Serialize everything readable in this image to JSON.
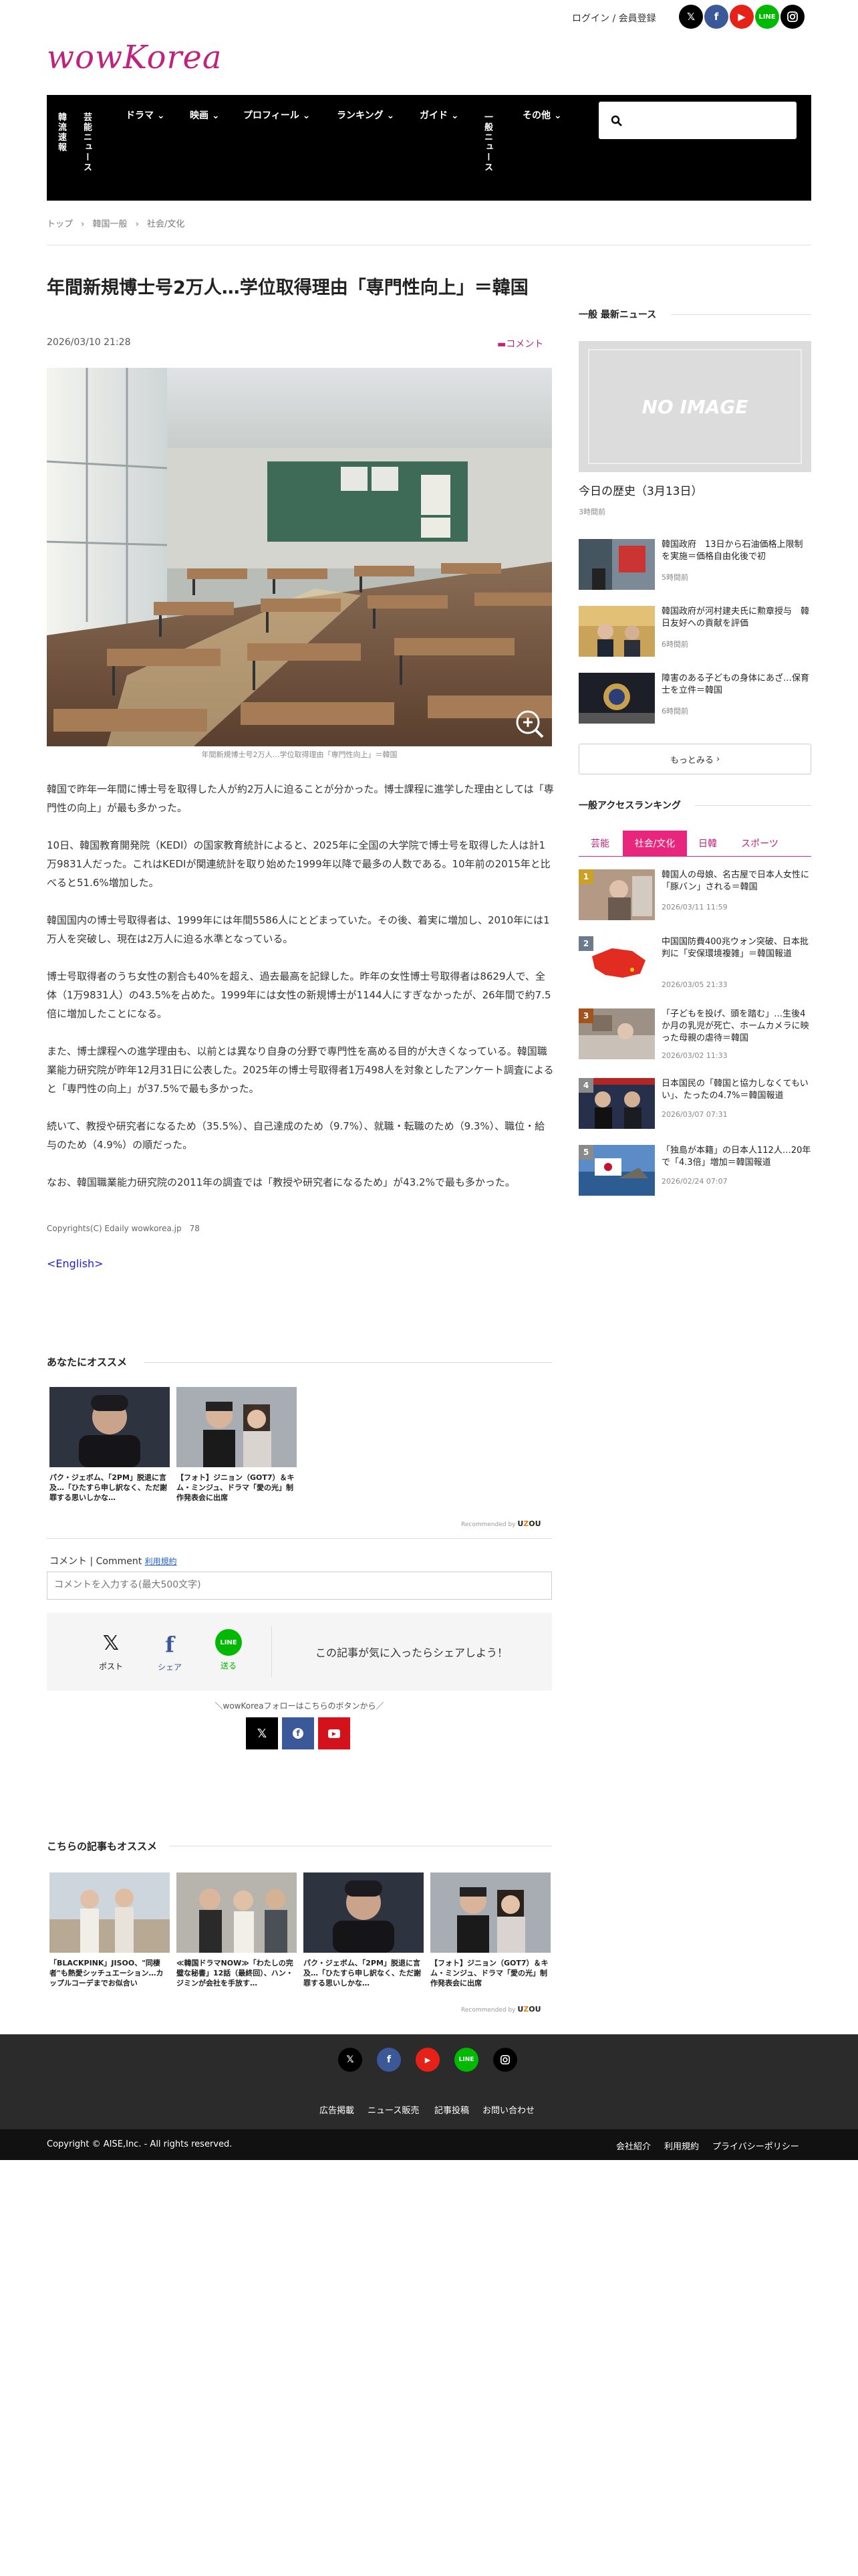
{
  "header": {
    "login_label": "ログイン / 会員登録",
    "logo": "wowKorea",
    "social": [
      "x-icon",
      "facebook-icon",
      "youtube-icon",
      "line-icon",
      "instagram-icon"
    ]
  },
  "nav": {
    "vertical": [
      "韓流速報",
      "芸能ニュース",
      "一般ニュース"
    ],
    "items": [
      "ドラマ",
      "映画",
      "プロフィール",
      "ランキング",
      "ガイド",
      "その他"
    ],
    "search_placeholder": ""
  },
  "breadcrumb": [
    "トップ",
    "韓国一般",
    "社会/文化"
  ],
  "article": {
    "title": "年間新規博士号2万人…学位取得理由「専門性向上」＝韓国",
    "date": "2026/03/10 21:28",
    "comment_label": "コメント",
    "caption": "年間新規博士号2万人…学位取得理由「専門性向上」＝韓国",
    "paragraphs": [
      "韓国で昨年一年間に博士号を取得した人が約2万人に迫ることが分かった。博士課程に進学した理由としては「専門性の向上」が最も多かった。",
      "10日、韓国教育開発院（KEDI）の国家教育統計によると、2025年に全国の大学院で博士号を取得した人は計1万9831人だった。これはKEDIが関連統計を取り始めた1999年以降で最多の人数である。10年前の2015年と比べると51.6%増加した。",
      "韓国国内の博士号取得者は、1999年には年間5586人にとどまっていた。その後、着実に増加し、2010年には1万人を突破し、現在は2万人に迫る水準となっている。",
      "博士号取得者のうち女性の割合も40%を超え、過去最高を記録した。昨年の女性博士号取得者は8629人で、全体（1万9831人）の43.5%を占めた。1999年には女性の新規博士が1144人にすぎなかったが、26年間で約7.5倍に増加したことになる。",
      "また、博士課程への進学理由も、以前とは異なり自身の分野で専門性を高める目的が大きくなっている。韓国職業能力研究院が昨年12月31日に公表した。2025年の博士号取得者1万498人を対象としたアンケート調査によると「専門性の向上」が37.5%で最も多かった。",
      "続いて、教授や研究者になるため（35.5%）、自己達成のため（9.7%）、就職・転職のため（9.3%）、職位・給与のため（4.9%）の順だった。",
      "なお、韓国職業能力研究院の2011年の調査では「教授や研究者になるため」が43.2%で最も多かった。"
    ],
    "copyright": "Copyrights(C) Edaily wowkorea.jp　78",
    "english_link": "<English>"
  },
  "reco1": {
    "heading": "あなたにオススメ",
    "cards": [
      "パク・ジェボム、「2PM」脱退に言及…「ひたすら申し訳なく、ただ謝罪する思いしかな…",
      "【フォト】ジニョン（GOT7）＆キム・ミンジュ、ドラマ「愛の光」制作発表会に出席"
    ],
    "powered": "Recommended by"
  },
  "comment": {
    "label": "コメント | Comment",
    "terms": "利用規約",
    "placeholder": "コメントを入力する(最大500文字)"
  },
  "share": {
    "buttons": [
      "ポスト",
      "シェア",
      "送る"
    ],
    "message": "この記事が気に入ったらシェアしよう！",
    "follow": "＼wowKoreaフォローはこちらのボタンから／"
  },
  "reco2": {
    "heading": "こちらの記事もオススメ",
    "cards": [
      "「BLACKPINK」JISOO、\"同棲者\"も熱愛シッチュエーション…カップルコーデまでお似合い",
      "≪韓国ドラマNOW≫「わたしの完璧な秘書」12話（最終回）、ハン・ジミンが会社を手放す…",
      "パク・ジェボム、「2PM」脱退に言及…「ひたすら申し訳なく、ただ謝罪する思いしかな…",
      "【フォト】ジニョン（GOT7）＆キム・ミンジュ、ドラマ「愛の光」制作発表会に出席"
    ],
    "powered": "Recommended by"
  },
  "sidebar": {
    "latest_heading": "一般 最新ニュース",
    "no_image": "NO IMAGE",
    "today_title": "今日の歴史（3月13日）",
    "today_time": "3時間前",
    "latest": [
      {
        "title": "韓国政府　13日から石油価格上限制を実施＝価格自由化後で初",
        "time": "5時間前"
      },
      {
        "title": "韓国政府が河村建夫氏に勲章授与　韓日友好への貢献を評価",
        "time": "6時間前"
      },
      {
        "title": "障害のある子どもの身体にあざ…保育士を立件＝韓国",
        "time": "6時間前"
      }
    ],
    "more": "もっとみる",
    "ranking_heading": "一般アクセスランキング",
    "tabs": [
      "芸能",
      "社会/文化",
      "日韓",
      "スポーツ"
    ],
    "ranking": [
      {
        "title": "韓国人の母娘、名古屋で日本人女性に「豚バン」される＝韓国",
        "time": "2026/03/11 11:59"
      },
      {
        "title": "中国国防費400兆ウォン突破、日本批判に「安保環境複雑」＝韓国報道",
        "time": "2026/03/05 21:33"
      },
      {
        "title": "「子どもを投げ、頭を踏む」…生後4か月の乳児が死亡、ホームカメラに映った母親の虐待＝韓国",
        "time": "2026/03/02 11:33"
      },
      {
        "title": "日本国民の「韓国と協力しなくてもいい」、たったの4.7%＝韓国報道",
        "time": "2026/03/07 07:31"
      },
      {
        "title": "「独島が本籍」の日本人112人…20年で「4.3倍」増加＝韓国報道",
        "time": "2026/02/24 07:07"
      }
    ]
  },
  "footer": {
    "links": [
      "広告掲載",
      "ニュース販売",
      "記事投稿",
      "お問い合わせ"
    ],
    "copyright": "Copyright © AISE,Inc. - All rights reserved.",
    "bottom_links": [
      "会社紹介",
      "利用規約",
      "プライバシーポリシー"
    ]
  },
  "colors": {
    "brand": "#c0237e",
    "nav_bg": "#000000",
    "footer_bg": "#2b2b2b"
  }
}
